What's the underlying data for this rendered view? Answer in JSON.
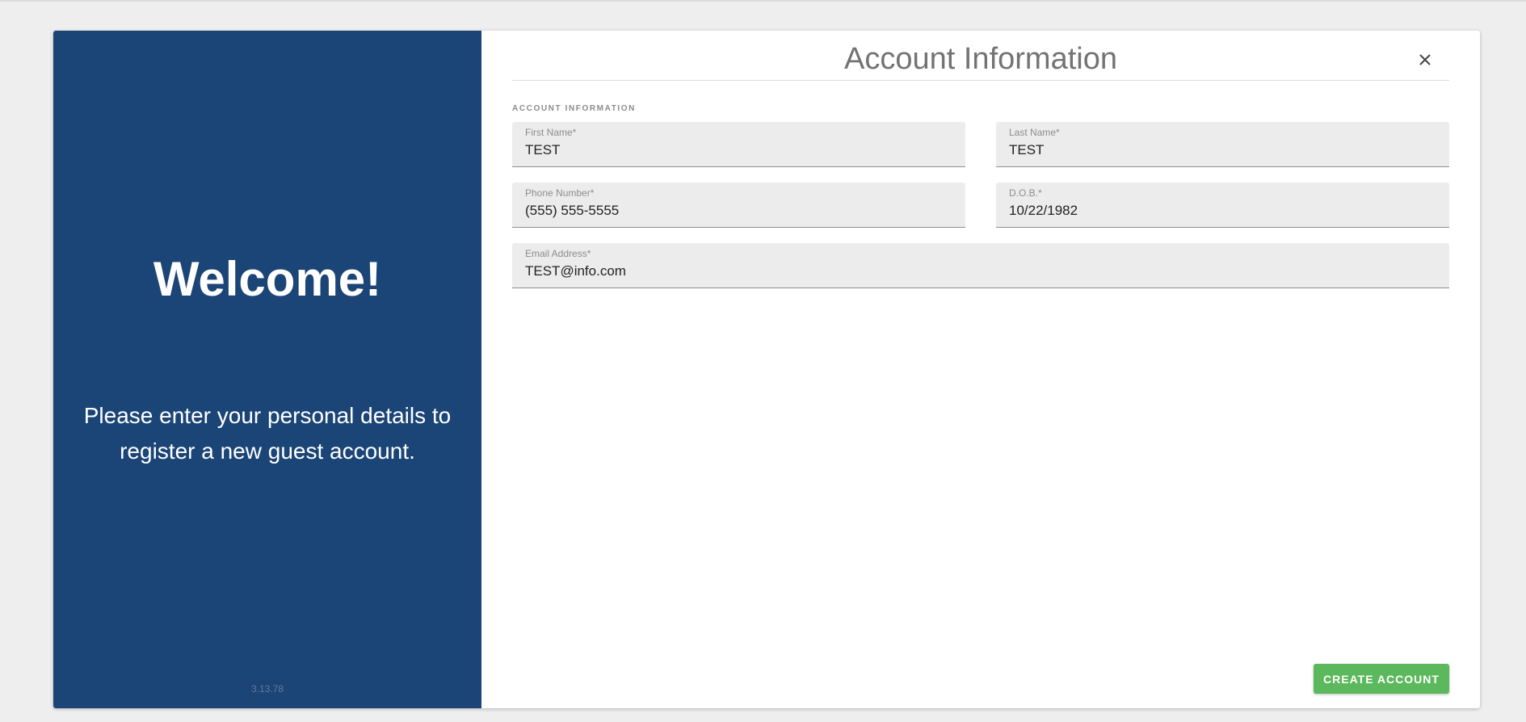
{
  "left_panel": {
    "heading": "Welcome!",
    "subtitle": "Please enter your personal details to register a new guest account.",
    "version": "3.13.78"
  },
  "dialog": {
    "title": "Account Information",
    "close_icon": "close-icon",
    "section_label": "ACCOUNT INFORMATION"
  },
  "fields": {
    "first_name": {
      "label": "First Name*",
      "value": "TEST"
    },
    "last_name": {
      "label": "Last Name*",
      "value": "TEST"
    },
    "phone": {
      "label": "Phone Number*",
      "value": "(555) 555-5555"
    },
    "dob": {
      "label": "D.O.B.*",
      "value": "10/22/1982"
    },
    "email": {
      "label": "Email Address*",
      "value": "TEST@info.com"
    }
  },
  "actions": {
    "create_account_label": "CREATE ACCOUNT"
  },
  "colors": {
    "panel_bg": "#1b4577",
    "primary_button": "#5cb85c",
    "field_bg": "#ececec"
  }
}
